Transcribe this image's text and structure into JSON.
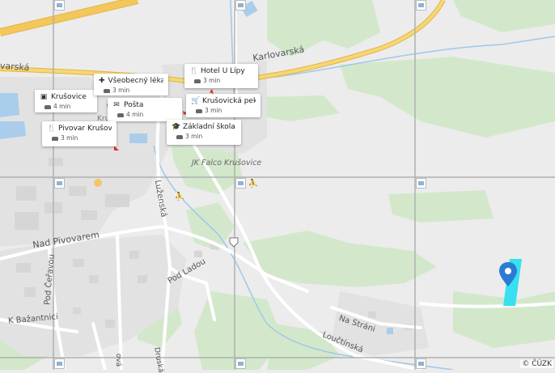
{
  "map": {
    "street_labels": [
      {
        "id": "karlovarska-1",
        "text": "Karlovarská"
      },
      {
        "id": "karlovarska-2",
        "text": "varská"
      },
      {
        "id": "luzenska",
        "text": "Luženská"
      },
      {
        "id": "nad-pivovarem",
        "text": "Nad Pivovarem"
      },
      {
        "id": "pod-ladou",
        "text": "Pod Ladou"
      },
      {
        "id": "pod-cesavou",
        "text": "Pod Čeřavou"
      },
      {
        "id": "k-bazantnici",
        "text": "K Bažantnici"
      },
      {
        "id": "na-strani",
        "text": "Na Stráni"
      },
      {
        "id": "lovetinska",
        "text": "Loučtínská"
      },
      {
        "id": "falco",
        "text": "JK Falco Krušovice"
      },
      {
        "id": "kru",
        "text": "Kru"
      },
      {
        "id": "ova",
        "text": "ová"
      },
      {
        "id": "druska",
        "text": "Druská"
      }
    ],
    "pois": [
      {
        "id": "krusovice-bus",
        "icon": "bus-icon",
        "name": "Krušovice",
        "time": "4 min"
      },
      {
        "id": "lekar",
        "icon": "medical-cross-icon",
        "name": "Všeobecný lékař ...",
        "time": "3 min"
      },
      {
        "id": "hotel",
        "icon": "restaurant-icon",
        "name": "Hotel U Lípy",
        "time": "3 min"
      },
      {
        "id": "posta",
        "icon": "post-icon",
        "name": "Pošta",
        "time": "4 min"
      },
      {
        "id": "pekarna",
        "icon": "shopping-cart-icon",
        "name": "Krušovická pekár...",
        "time": "3 min"
      },
      {
        "id": "pivovar",
        "icon": "restaurant-icon",
        "name": "Pivovar Krušovice",
        "time": "3 min"
      },
      {
        "id": "skola",
        "icon": "school-icon",
        "name": "Základní škola Kr...",
        "time": "3 min"
      }
    ],
    "copyright": "© ČÚZK",
    "colors": {
      "background": "#ececec",
      "forest": "#cfe6c6",
      "water": "#a9cdeb",
      "highway": "#f3c75a",
      "road": "#ffffff",
      "marker": "#2a7bd4",
      "highlight": "#37e0f0",
      "grid": "#b0b0b0"
    }
  }
}
